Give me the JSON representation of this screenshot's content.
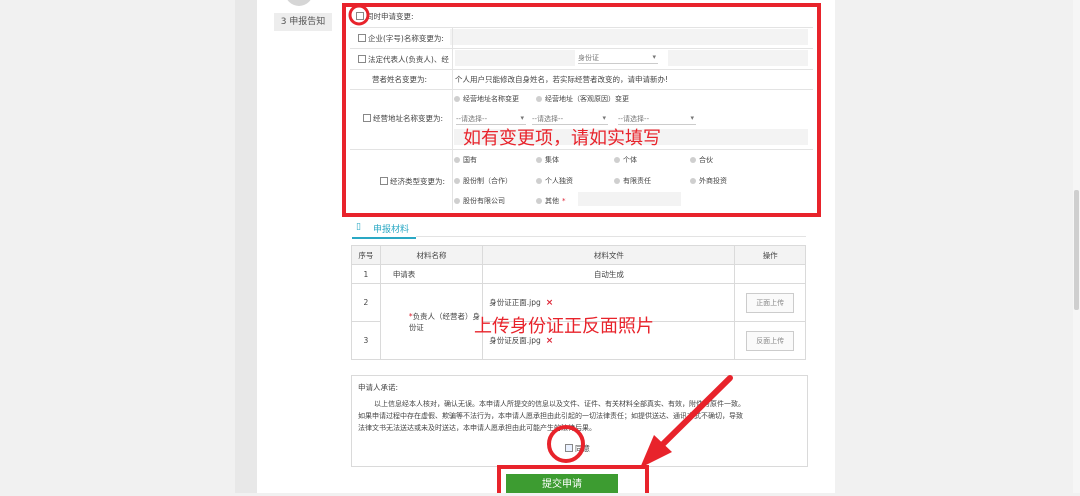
{
  "step": {
    "label": "3 申报告知"
  },
  "change_form": {
    "apply_change": {
      "label": "同时申请变更:"
    },
    "enterprise_name": {
      "label": "企业(字号)名称变更为:"
    },
    "legal_rep": {
      "label": "法定代表人(负责人)、经",
      "id_type": "身份证"
    },
    "operator_name": {
      "label": "营者姓名变更为:",
      "notice": "个人用户只能修改自身姓名，若实际经营者改变的，请申请新办!"
    },
    "address": {
      "label": "经营地址名称变更为:",
      "option1": "经营地址名称变更",
      "option2": "经营地址（客观原因）变更",
      "select1": "--请选择--",
      "select2": "--请选择--",
      "select3": "--请选择--"
    },
    "econ_type": {
      "label": "经济类型变更为:",
      "options": [
        "国有",
        "集体",
        "个体",
        "合伙",
        "股份制（合作）",
        "个人独资",
        "有限责任",
        "外商投资",
        "股份有限公司",
        "其他"
      ],
      "required_mark": "*"
    }
  },
  "materials": {
    "title": "申报材料",
    "headers": {
      "seq": "序号",
      "name": "材料名称",
      "file": "材料文件",
      "action": "操作"
    },
    "rows": [
      {
        "seq": "1",
        "name": "申请表",
        "file": "自动生成",
        "action": ""
      },
      {
        "seq": "2",
        "name": "",
        "file": "身份证正面.jpg",
        "action": "正面上传"
      },
      {
        "seq": "3",
        "name": "",
        "file": "身份证反面.jpg",
        "action": "反面上传"
      }
    ],
    "merged_name": "负责人（经营者）身份证",
    "required_mark": "*",
    "delete_icon": "×"
  },
  "commitment": {
    "title": "申请人承诺:",
    "line1": "以上信息经本人核对，确认无误。本申请人所提交的信息以及文件、证件、有关材料全部真实、有效，附件与原件一致。",
    "line2": "如果申请过程中存在虚假、欺骗等不法行为，本申请人愿承担由此引起的一切法律责任；如提供送达、通讯方式不确切，导致",
    "line3": "法律文书无法送达或未及时送达，本申请人愿承担由此可能产生的法律后果。",
    "agree": "同意"
  },
  "submit": {
    "label": "提交申请"
  },
  "annotations": {
    "fill_hint": "如有变更项，请如实填写",
    "upload_hint": "上传身份证正反面照片"
  },
  "colors": {
    "highlight": "#e8232b",
    "accent": "#2aa8c4",
    "submit_bg": "#3d9c31"
  }
}
